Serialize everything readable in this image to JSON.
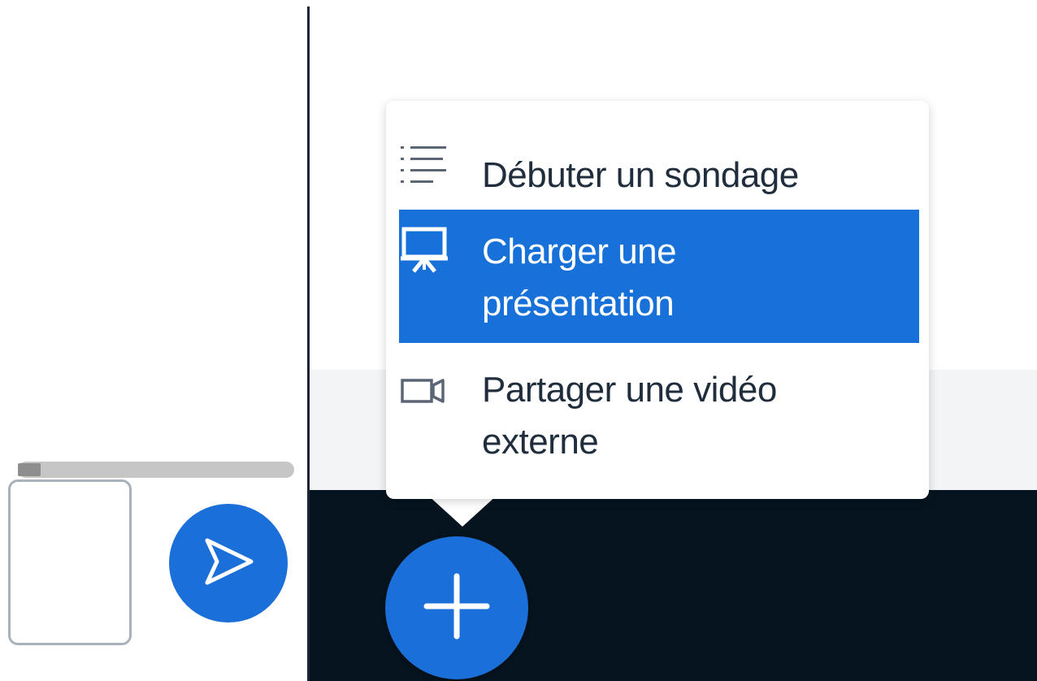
{
  "menu": {
    "items": [
      {
        "label": "Débuter un sondage",
        "icon": "poll-list-icon"
      },
      {
        "label": "Charger une présentation",
        "line1": "Charger une",
        "line2": "présentation",
        "icon": "presentation-icon",
        "selected": true
      },
      {
        "label": "Partager une vidéo externe",
        "line1": "Partager une vidéo",
        "line2": "externe",
        "icon": "video-camera-icon"
      }
    ]
  },
  "chat": {
    "send_icon": "send-icon"
  },
  "actions": {
    "plus_icon": "plus-icon"
  },
  "colors": {
    "accent": "#1b6fd8",
    "selected_item": "#1771d9",
    "action_bar": "#06141f",
    "divider": "#1c2535"
  }
}
